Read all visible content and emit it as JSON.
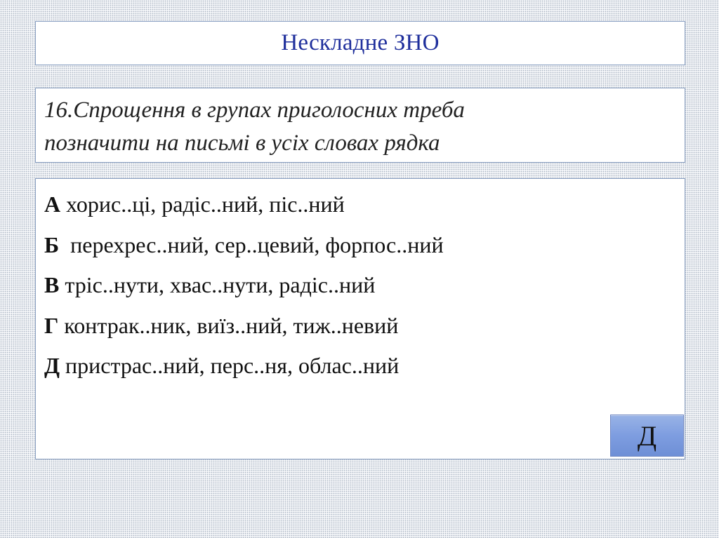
{
  "title": "Нескладне ЗНО",
  "question": {
    "line1": "16.Спрощення в групах приголосних треба",
    "line2": "позначити на письмі в усіх словах рядка"
  },
  "options": [
    {
      "letter": "А",
      "text": "хорис..ці, радіс..ний, піс..ний"
    },
    {
      "letter": "Б",
      "text": " перехрес..ний, сер..цевий, форпос..ний"
    },
    {
      "letter": "В",
      "text": "тріс..нути, хвас..нути, радіс..ний"
    },
    {
      "letter": "Г",
      "text": "контрак..ник, виїз..ний, тиж..невий"
    },
    {
      "letter": "Д",
      "text": "пристрас..ний, перс..ня, облас..ний"
    }
  ],
  "answer_button": {
    "label": "Д"
  },
  "colors": {
    "title": "#1f2f9c",
    "panel_border": "#8aa0c2",
    "button": "#7e9de0"
  }
}
